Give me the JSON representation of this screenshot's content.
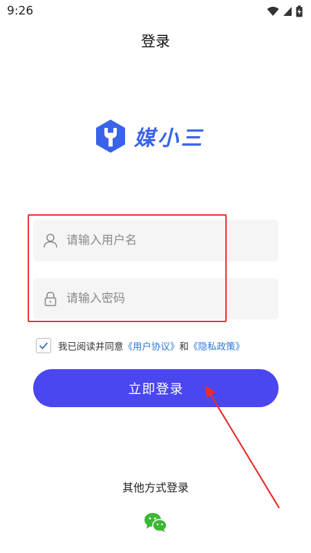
{
  "status_bar": {
    "time": "9:26",
    "icons": [
      "wifi-icon",
      "signal-icon",
      "battery-icon"
    ]
  },
  "header": {
    "title": "登录"
  },
  "logo": {
    "text": "媒小三",
    "icon": "logo-mark-icon",
    "color": "#3a63e8"
  },
  "form": {
    "username_placeholder": "请输入用户名",
    "password_placeholder": "请输入密码",
    "username_icon": "user-icon",
    "password_icon": "lock-icon"
  },
  "agreement": {
    "checked": true,
    "prefix": "我已阅读并同意",
    "user_agreement": "《用户协议》",
    "and": "和",
    "privacy_policy": "《隐私政策》"
  },
  "login_button": {
    "label": "立即登录",
    "color": "#4a46f0"
  },
  "other_login": {
    "label": "其他方式登录",
    "options": [
      "wechat-icon"
    ]
  },
  "annotation": {
    "highlight_color": "#ee2b2b"
  }
}
